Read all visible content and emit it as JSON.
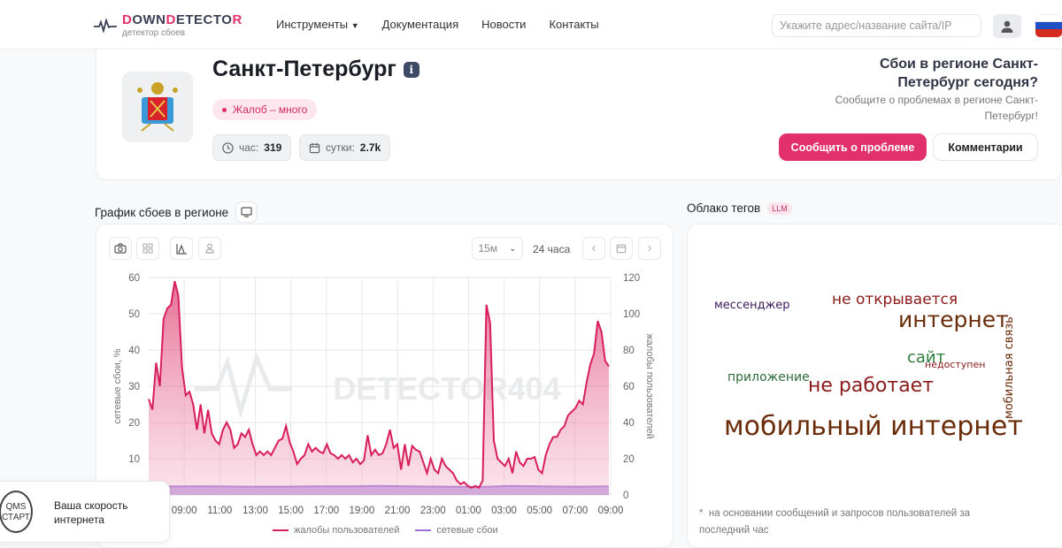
{
  "header": {
    "logo_parts": [
      "D",
      "OWN",
      "D",
      "ETECTO",
      "R"
    ],
    "logo_sub": "детектор сбоев",
    "nav": [
      "Инструменты",
      "Документация",
      "Новости",
      "Контакты"
    ],
    "search_placeholder": "Укажите адрес/название сайта/IP"
  },
  "region": {
    "name": "Санкт-Петербург",
    "info": "i",
    "status": "Жалоб – много",
    "hour_label": "час:",
    "hour_value": "319",
    "day_label": "сутки:",
    "day_value": "2.7k"
  },
  "report": {
    "question": "Сбои в регионе Санкт-Петербург сегодня?",
    "subtitle": "Сообщите о проблемах в регионе Санкт-Петербург!",
    "report_button": "Сообщить о проблеме",
    "comments_button": "Комментарии"
  },
  "chart_section": {
    "title": "График сбоев в регионе",
    "interval": "15м",
    "period": "24 часа"
  },
  "chart_data": {
    "type": "area",
    "x_start_label": "07:00",
    "x_range_hours": [
      0,
      26
    ],
    "x_tick_labels": [
      "09:00",
      "11:00",
      "13:00",
      "15:00",
      "17:00",
      "19:00",
      "21:00",
      "23:00",
      "01:00",
      "03:00",
      "05:00",
      "07:00",
      "09:00"
    ],
    "ylabel_left": "сетевые сбои, %",
    "ylim_left": [
      0,
      60
    ],
    "yticks_left": [
      "60",
      "50",
      "40",
      "30",
      "20",
      "10"
    ],
    "ylabel_right": "жалобы пользователей",
    "ylim_right": [
      0,
      120
    ],
    "yticks_right": [
      "120",
      "100",
      "80",
      "60",
      "40",
      "20",
      "0"
    ],
    "watermark": "DETECTOR404",
    "series": [
      {
        "name": "жалобы пользователей",
        "axis": "right",
        "color": "#d81e5b",
        "x_hours_end": 25.9,
        "values": [
          53,
          47,
          73,
          60,
          97,
          103,
          105,
          118,
          110,
          70,
          55,
          57,
          50,
          36,
          50,
          34,
          47,
          34,
          30,
          28,
          36,
          40,
          36,
          26,
          28,
          34,
          32,
          36,
          28,
          22,
          24,
          22,
          24,
          22,
          26,
          30,
          31,
          38,
          29,
          24,
          17,
          20,
          22,
          28,
          24,
          26,
          24,
          23,
          28,
          23,
          22,
          20,
          22,
          20,
          22,
          18,
          20,
          17,
          19,
          33,
          22,
          25,
          22,
          23,
          28,
          36,
          26,
          28,
          14,
          28,
          16,
          27,
          25,
          24,
          18,
          12,
          20,
          14,
          12,
          20,
          16,
          14,
          12,
          8,
          6,
          7,
          5,
          4,
          5,
          4,
          8,
          105,
          95,
          30,
          20,
          18,
          16,
          20,
          12,
          24,
          18,
          16,
          20,
          20,
          21,
          14,
          12,
          22,
          28,
          32,
          32,
          36,
          38,
          44,
          46,
          48,
          52,
          50,
          62,
          72,
          78,
          96,
          90,
          74,
          71
        ]
      },
      {
        "name": "сетевые сбои",
        "axis": "left",
        "color": "#9b6fd6",
        "x_hours_end": 25.9,
        "values": [
          2.3,
          2.4,
          2.4,
          2.3,
          2.3,
          2.4,
          2.4,
          2.5,
          2.4,
          2.3,
          2.2,
          2.5,
          2.4,
          2.3,
          2.4
        ]
      }
    ],
    "legend": [
      "жалобы пользователей",
      "сетевые сбои"
    ],
    "legend_position": "bottom"
  },
  "tags": {
    "title": "Облако тегов",
    "badge": "LLM",
    "words": [
      {
        "text": "мессенджер",
        "color": "#3b1a5a"
      },
      {
        "text": "не открывается",
        "color": "#8b1a1a"
      },
      {
        "text": "интернет",
        "color": "#6b2c0a"
      },
      {
        "text": "мобильная связь",
        "color": "#6b2c0a"
      },
      {
        "text": "сайт",
        "color": "#2e7d3a"
      },
      {
        "text": "недоступен",
        "color": "#8b1a1a"
      },
      {
        "text": "приложение",
        "color": "#2e6b3a"
      },
      {
        "text": "не работает",
        "color": "#8b1a1a"
      },
      {
        "text": "мобильный интернет",
        "color": "#6b2c0a"
      }
    ],
    "footnote_mark": "*",
    "footnote": "на основании сообщений и запросов пользователей за последний час"
  },
  "widget": {
    "logo": "QMS СТАРТ",
    "text": "Ваша скорость интернета"
  }
}
